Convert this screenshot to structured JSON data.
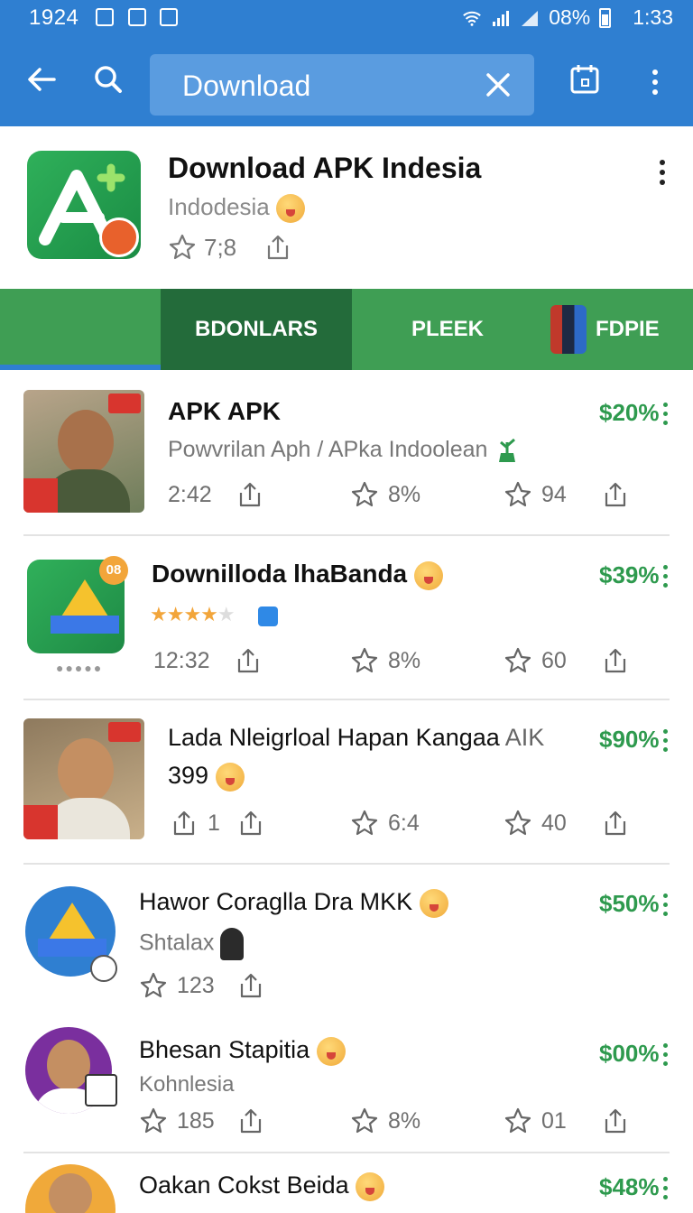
{
  "status_bar": {
    "left_time": "1924",
    "right_battery": "08%",
    "right_time": "1:33"
  },
  "app_bar": {
    "search_value": "Download",
    "icons": [
      "back-arrow-icon",
      "search-icon",
      "clear-icon",
      "calendar-icon",
      "more-vert-icon"
    ]
  },
  "app_header": {
    "title": "Download APK Indesia",
    "subtitle": "Indodesia",
    "rating": "7;8"
  },
  "tabs": [
    {
      "label": ""
    },
    {
      "label": "BDONLARS",
      "active": true
    },
    {
      "label": "PLEEK"
    },
    {
      "label": "FDPIE"
    }
  ],
  "items": [
    {
      "title": "APK APK",
      "subtitle": "Powvrilan Aph / APka Indoolean",
      "time": "2:42",
      "stat1": "8%",
      "stat2": "94",
      "price": "$20%"
    },
    {
      "title": "Downilloda lhaBanda",
      "badge": "08",
      "time": "12:32",
      "stat1": "8%",
      "stat2": "60",
      "price": "$39%",
      "rating_stars": 3.5
    },
    {
      "title": "Lada Nleigrloal Hapan Kangaa",
      "title_suffix": "AIK",
      "line2": "399",
      "stat0": "1",
      "stat1": "6:4",
      "stat2": "40",
      "price": "$90%"
    },
    {
      "title": "Hawor Coraglla Dra MKK",
      "subtitle": "Shtalax",
      "stat0": "123",
      "price": "$50%"
    },
    {
      "title": "Bhesan Stapitia",
      "subtitle": "Kohnlesia",
      "stat0": "185",
      "stat1": "8%",
      "stat2": "01",
      "price": "$00%"
    },
    {
      "title": "Oakan Cokst Beida",
      "price": "$48%"
    }
  ],
  "colors": {
    "primary": "#2f7fd1",
    "tab_green": "#3f9e54",
    "tab_active": "#236b3a",
    "price_green": "#2e9a4e"
  }
}
